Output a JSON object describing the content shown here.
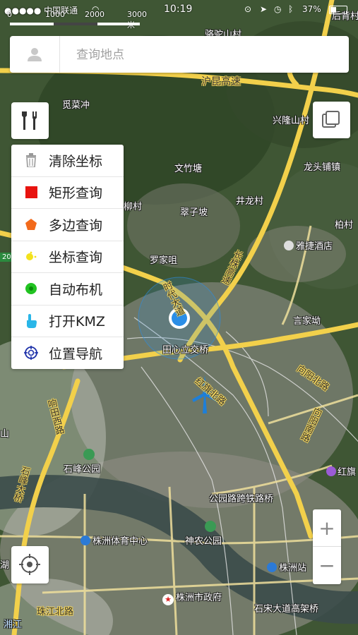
{
  "status_bar": {
    "carrier": "●●●●● 中国联通",
    "time": "10:19",
    "battery": "37%"
  },
  "scale": {
    "ticks": [
      "0",
      "1000",
      "2000",
      "3000 米"
    ]
  },
  "search": {
    "placeholder": "查询地点"
  },
  "tool_menu": {
    "items": [
      {
        "label": "清除坐标",
        "icon": "trash-icon"
      },
      {
        "label": "矩形查询",
        "icon": "red-square-icon"
      },
      {
        "label": "多边查询",
        "icon": "orange-pentagon-icon"
      },
      {
        "label": "坐标查询",
        "icon": "yellow-pin-icon"
      },
      {
        "label": "自动布机",
        "icon": "green-dot-icon"
      },
      {
        "label": "打开KMZ",
        "icon": "hand-pointer-icon"
      },
      {
        "label": "位置导航",
        "icon": "navigation-target-icon"
      }
    ]
  },
  "zoom": {
    "in": "+",
    "out": "−"
  },
  "map_labels": {
    "l1": "骆驼山村",
    "l2": "后背村",
    "l3": "沪昆高速",
    "l4": "觅菜冲",
    "l5": "兴隆山村",
    "l6": "文竹塘",
    "l7": "龙头铺镇",
    "l8": "井龙村",
    "l9": "柳村",
    "l10": "翠子坡",
    "l11": "柏村",
    "l12": "雅捷酒店",
    "l13": "罗家咀",
    "l14": "长株高速",
    "l15": "时代大道",
    "l16": "言家坳",
    "l17": "田心立交桥",
    "l18": "红旗北路",
    "l19": "向阳北路",
    "l20": "响田西路",
    "l21": "石峰公园",
    "l22": "红旗",
    "l23": "石峰大桥",
    "l24": "公园路跨铁路桥",
    "l25": "株洲体育中心",
    "l26": "神农公园",
    "l27": "株洲站",
    "l28": "株洲市政府",
    "l29": "珠江北路",
    "l30": "石宋大道高架桥",
    "l31": "湘江",
    "l32": "向阳南路",
    "l33": "山",
    "l34": "湖",
    "l35": "20"
  },
  "colors": {
    "highway": "#f2d04b",
    "road": "#f5e08a",
    "location_blue": "#2b8ee6",
    "menu_red": "#e8130f",
    "menu_orange": "#f26a1b",
    "menu_green": "#22c322"
  }
}
